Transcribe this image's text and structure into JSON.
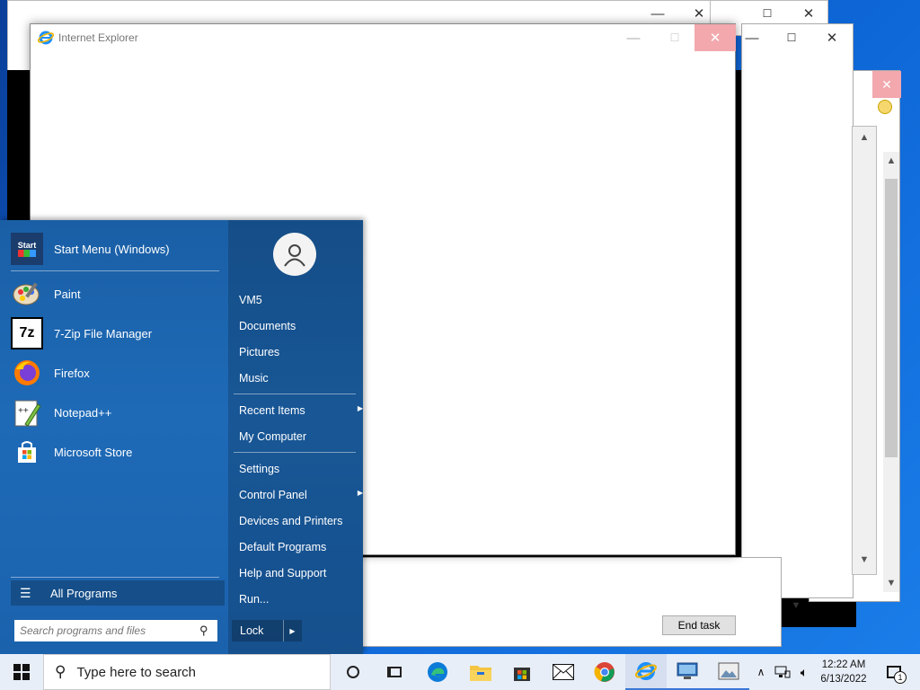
{
  "ie_window": {
    "title": "Internet Explorer"
  },
  "task_manager": {
    "end_task_label": "End task"
  },
  "start_menu": {
    "header_item": {
      "label": "Start Menu (Windows)",
      "icon": "start-menu-icon"
    },
    "pinned": [
      {
        "label": "Paint",
        "icon": "paint-icon"
      },
      {
        "label": "7-Zip File Manager",
        "icon": "7zip-icon"
      },
      {
        "label": "Firefox",
        "icon": "firefox-icon"
      },
      {
        "label": "Notepad++",
        "icon": "notepadpp-icon"
      },
      {
        "label": "Microsoft Store",
        "icon": "store-icon"
      }
    ],
    "all_programs": "All Programs",
    "search_placeholder": "Search programs and files",
    "user": "VM5",
    "right_items_1": [
      "Documents",
      "Pictures",
      "Music"
    ],
    "right_items_2": [
      {
        "label": "Recent Items",
        "submenu": true
      },
      {
        "label": "My Computer",
        "submenu": false
      }
    ],
    "right_items_3": [
      {
        "label": "Settings",
        "submenu": false
      },
      {
        "label": "Control Panel",
        "submenu": true
      },
      {
        "label": "Devices and Printers",
        "submenu": false
      },
      {
        "label": "Default Programs",
        "submenu": false
      },
      {
        "label": "Help and Support",
        "submenu": false
      },
      {
        "label": "Run...",
        "submenu": false
      }
    ],
    "lock_label": "Lock"
  },
  "taskbar": {
    "search_placeholder": "Type here to search",
    "apps": [
      "task-view-icon",
      "edge-icon",
      "file-explorer-icon",
      "store-icon",
      "mail-icon",
      "chrome-icon",
      "ie-icon",
      "remote-desktop-icon",
      "photo-app-icon"
    ],
    "clock_time": "12:22 AM",
    "clock_date": "6/13/2022",
    "notification_count": "1"
  }
}
